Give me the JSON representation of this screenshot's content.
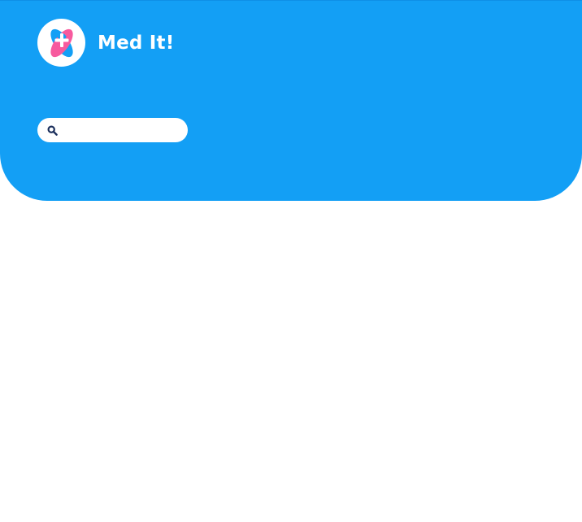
{
  "app": {
    "name": "Med It!"
  },
  "logo": {
    "icon": "medical-cross-logo-icon"
  },
  "search": {
    "icon": "search-icon",
    "placeholder": "",
    "value": ""
  },
  "colors": {
    "header_background": "#139ff5",
    "logo_pink": "#f75a9e",
    "logo_blue": "#139ff5",
    "search_icon": "#1b2f5c",
    "text_on_header": "#ffffff"
  }
}
